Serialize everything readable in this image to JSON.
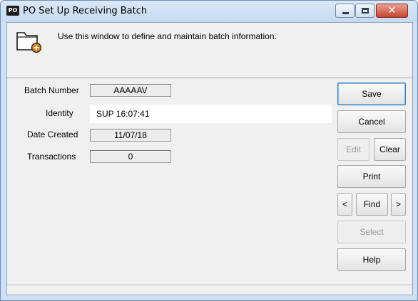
{
  "window": {
    "app_badge": "PO",
    "title": "PO Set Up Receiving Batch",
    "close_glyph": "✕"
  },
  "header": {
    "icon": "folder-add-icon",
    "description": "Use this window to define and maintain batch information."
  },
  "form": {
    "batch_number_label": "Batch Number",
    "batch_number_value": "AAAAAV",
    "identity_label": "Identity",
    "identity_value": "SUP 16:07:41",
    "date_created_label": "Date Created",
    "date_created_value": "11/07/18",
    "transactions_label": "Transactions",
    "transactions_value": "0"
  },
  "buttons": {
    "save": "Save",
    "cancel": "Cancel",
    "edit": "Edit",
    "clear": "Clear",
    "print": "Print",
    "prev": "<",
    "find": "Find",
    "next": ">",
    "select": "Select",
    "help": "Help"
  },
  "colors": {
    "accent_close": "#c7442d",
    "default_button_border": "#3c7fb1",
    "folder_badge": "#e07a10"
  }
}
